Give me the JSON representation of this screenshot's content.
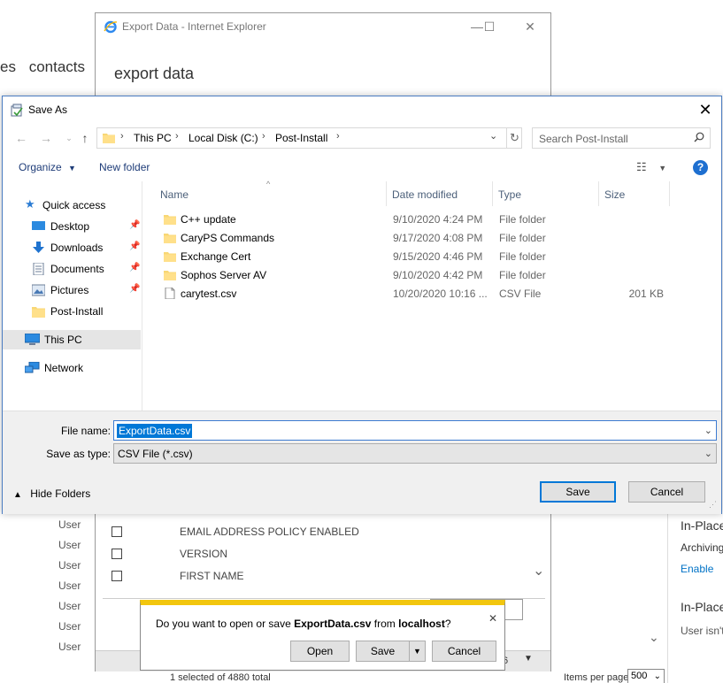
{
  "background": {
    "nav_left": "es",
    "nav_contacts": "contacts",
    "user_rows": [
      "User",
      "User",
      "User",
      "User",
      "User",
      "User",
      "User"
    ],
    "right_panel": {
      "inplace_1": "In-Place",
      "archiving": "Archiving",
      "enable": "Enable",
      "inplace_2": "In-Place",
      "user_isnt": "User isn't"
    },
    "selected_count": "1 selected of 4880 total",
    "items_per_page_label": "Items per page",
    "items_per_page_value": "500"
  },
  "ie_window": {
    "title": "Export Data - Internet Explorer",
    "heading": "export data",
    "rows": [
      "EMAIL ADDRESS POLICY ENABLED",
      "VERSION",
      "FIRST NAME"
    ],
    "pct_fragment": "6"
  },
  "save_dialog": {
    "title": "Save As",
    "breadcrumb": [
      "This PC",
      "Local Disk (C:)",
      "Post-Install"
    ],
    "search_placeholder": "Search Post-Install",
    "toolbar": {
      "organize": "Organize",
      "new_folder": "New folder"
    },
    "nav": [
      {
        "label": "Quick access",
        "icon": "star-icon",
        "pinned": false
      },
      {
        "label": "Desktop",
        "icon": "desktop-icon",
        "pinned": true
      },
      {
        "label": "Downloads",
        "icon": "download-icon",
        "pinned": true
      },
      {
        "label": "Documents",
        "icon": "documents-icon",
        "pinned": true
      },
      {
        "label": "Pictures",
        "icon": "pictures-icon",
        "pinned": true
      },
      {
        "label": "Post-Install",
        "icon": "folder-icon",
        "pinned": false
      },
      {
        "label": "This PC",
        "icon": "computer-icon",
        "pinned": false
      },
      {
        "label": "Network",
        "icon": "network-icon",
        "pinned": false
      }
    ],
    "columns": {
      "name": "Name",
      "date": "Date modified",
      "type": "Type",
      "size": "Size"
    },
    "files": [
      {
        "name": "C++ update",
        "date": "9/10/2020 4:24 PM",
        "type": "File folder",
        "size": "",
        "icon": "folder-icon"
      },
      {
        "name": "CaryPS Commands",
        "date": "9/17/2020 4:08 PM",
        "type": "File folder",
        "size": "",
        "icon": "folder-icon"
      },
      {
        "name": "Exchange Cert",
        "date": "9/15/2020 4:46 PM",
        "type": "File folder",
        "size": "",
        "icon": "folder-icon"
      },
      {
        "name": "Sophos Server AV",
        "date": "9/10/2020 4:42 PM",
        "type": "File folder",
        "size": "",
        "icon": "folder-icon"
      },
      {
        "name": "carytest.csv",
        "date": "10/20/2020 10:16 ...",
        "type": "CSV File",
        "size": "201 KB",
        "icon": "file-icon"
      }
    ],
    "file_name_label": "File name:",
    "file_name_value": "ExportData.csv",
    "save_type_label": "Save as type:",
    "save_type_value": "CSV File (*.csv)",
    "hide_folders": "Hide Folders",
    "save_button": "Save",
    "cancel_button": "Cancel"
  },
  "notification": {
    "prefix": "Do you want to open or save ",
    "file": "ExportData.csv",
    "middle": " from ",
    "host": "localhost",
    "suffix": "?",
    "open": "Open",
    "save": "Save",
    "cancel": "Cancel"
  },
  "colors": {
    "accent": "#0078d7",
    "notification_bar": "#f2c60e",
    "folder": "#f8d775"
  }
}
